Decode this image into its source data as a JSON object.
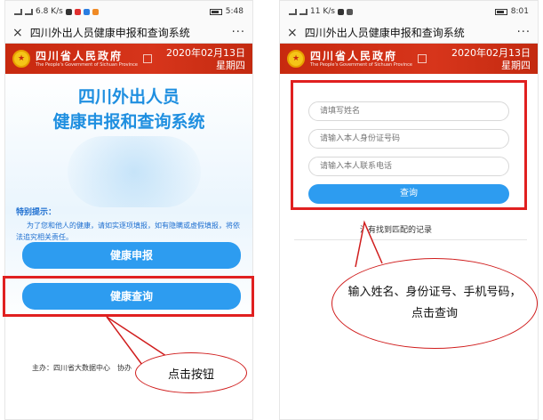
{
  "left": {
    "status": {
      "network": "6.8 K/s",
      "time": "5:48"
    },
    "titlebar": {
      "close": "×",
      "title": "四川外出人员健康申报和查询系统",
      "more": "···"
    },
    "gov": {
      "name_cn": "四川省人民政府",
      "name_en": "The People's Government of Sichuan Province",
      "date": "2020年02月13日",
      "weekday": "星期四"
    },
    "system_title_line1": "四川外出人员",
    "system_title_line2": "健康申报和查询系统",
    "notice_title": "特别提示：",
    "notice_body": "为了您和他人的健康，请如实逐项填报，如有隐瞒或虚假填报，将依法追究相关责任。",
    "buttons": {
      "report": "健康申报",
      "query": "健康查询"
    },
    "footer": "主办：四川省大数据中心　协办",
    "callout": "点击按钮"
  },
  "right": {
    "status": {
      "network": "11 K/s",
      "time": "8:01"
    },
    "titlebar": {
      "close": "×",
      "title": "四川外出人员健康申报和查询系统",
      "more": "···"
    },
    "gov": {
      "name_cn": "四川省人民政府",
      "name_en": "The People's Government of Sichuan Province",
      "date": "2020年02月13日",
      "weekday": "星期四"
    },
    "form": {
      "name_placeholder": "请填写姓名",
      "id_placeholder": "请输入本人身份证号码",
      "phone_placeholder": "请输入本人联系电话",
      "search": "查询"
    },
    "no_record": "没有找到匹配的记录",
    "callout": "输入姓名、身份证号、手机号码，点击查询"
  },
  "colors": {
    "accent_blue": "#2d9cf0",
    "title_blue": "#1f8fe0",
    "header_red": "#c7290f",
    "highlight_red": "#e02020"
  },
  "icons": [
    "close-icon",
    "more-icon",
    "emblem-icon",
    "battery-icon",
    "signal-icon"
  ]
}
